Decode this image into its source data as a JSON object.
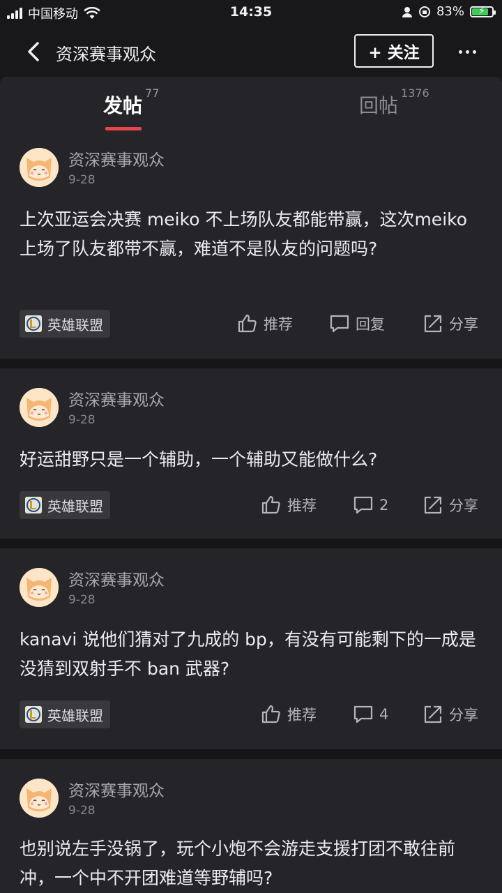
{
  "status_bar": {
    "carrier": "中国移动",
    "time": "14:35",
    "battery": "83%",
    "battery_level": 0.83
  },
  "header": {
    "title": "资深赛事观众",
    "follow_label": "+ 关注"
  },
  "tabs": [
    {
      "label": "发帖",
      "count": "77"
    },
    {
      "label": "回帖",
      "count": "1376"
    }
  ],
  "posts": [
    {
      "author": "资深赛事观众",
      "date": "9-28",
      "text": "上次亚运会决赛 meiko 不上场队友都能带赢，这次meiko 上场了队友都带不赢，难道不是队友的问题吗?",
      "tag": "英雄联盟",
      "recommend": "推荐",
      "reply": "回复",
      "share": "分享"
    },
    {
      "author": "资深赛事观众",
      "date": "9-28",
      "text": "好运甜野只是一个辅助，一个辅助又能做什么?",
      "tag": "英雄联盟",
      "recommend": "推荐",
      "reply": "2",
      "share": "分享"
    },
    {
      "author": "资深赛事观众",
      "date": "9-28",
      "text": "kanavi 说他们猜对了九成的 bp，有没有可能剩下的一成是没猜到双射手不 ban 武器?",
      "tag": "英雄联盟",
      "recommend": "推荐",
      "reply": "4",
      "share": "分享"
    },
    {
      "author": "资深赛事观众",
      "date": "9-28",
      "text": "也别说左手没锅了，玩个小炮不会游走支援打团不敢往前冲，一个中不开团难道等野辅吗?"
    }
  ]
}
